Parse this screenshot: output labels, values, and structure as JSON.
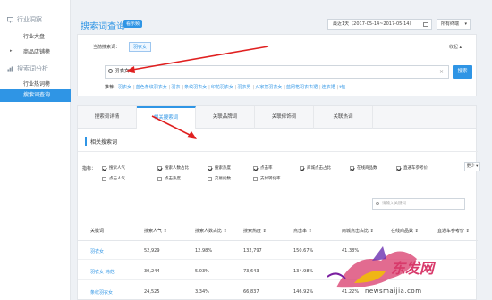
{
  "sidebar": {
    "sections": [
      {
        "label": "行业洞察",
        "icon": "chart-icon"
      },
      {
        "label": "搜索词分析",
        "icon": "bar-chart-icon"
      }
    ],
    "items": [
      {
        "label": "行业大盘"
      },
      {
        "label": "商品店铺榜"
      },
      {
        "label": "行业热词榜"
      },
      {
        "label": "搜索词查询"
      }
    ]
  },
  "header": {
    "title": "搜索词查询",
    "badge": "看示频",
    "date_range": "最近1天（2017-05-14~2017-05-14）",
    "terminal": "所有终端"
  },
  "query": {
    "current_label": "当前搜索词：",
    "current_term": "羽衣女",
    "collapse": "收起",
    "search_value": "羽衣女",
    "search_button": "搜索",
    "recommend_label": "推荐：",
    "recommend": [
      "羽衣女",
      "蓝色条纹羽衣女",
      "羽衣",
      "条纹羽衣女",
      "印花羽衣女",
      "羽衣男",
      "火家撞羽衣女",
      "蓝网格羽衣衣裙",
      "连衣裙",
      "t恤"
    ]
  },
  "tabs": [
    "搜索词详情",
    "相关搜索词",
    "关联品牌词",
    "关联修饰词",
    "关联热词"
  ],
  "section_title": "相关搜索词",
  "indicators": {
    "label": "指标：",
    "more": "更少",
    "items": [
      {
        "label": "搜索人气",
        "checked": true
      },
      {
        "label": "搜索人数占比",
        "checked": true
      },
      {
        "label": "搜索热度",
        "checked": true
      },
      {
        "label": "点击率",
        "checked": true
      },
      {
        "label": "商城点击占比",
        "checked": true
      },
      {
        "label": "在线商品数",
        "checked": true
      },
      {
        "label": "直通车参考价",
        "checked": true
      },
      {
        "label": "点击人气",
        "checked": false
      },
      {
        "label": "点击热度",
        "checked": false
      },
      {
        "label": "交易指数",
        "checked": false
      },
      {
        "label": "支付转化率",
        "checked": false
      }
    ]
  },
  "keyword_placeholder": "请输入关键词",
  "table": {
    "headers": [
      "关键词",
      "搜索人气",
      "搜索人数占比",
      "搜索热度",
      "点击率",
      "商城点击占比",
      "在线商品数",
      "直通车参考价"
    ],
    "rows": [
      [
        "羽衣女",
        "52,929",
        "12.98%",
        "132,797",
        "150.67%",
        "41.38%",
        "",
        ""
      ],
      [
        "羽衣女 韩范",
        "30,244",
        "5.03%",
        "73,643",
        "134.98%",
        "",
        "",
        ""
      ],
      [
        "条纹羽衣女",
        "24,525",
        "3.34%",
        "66,837",
        "146.92%",
        "41.22%",
        "",
        ""
      ]
    ]
  },
  "watermark": {
    "title": "东发网",
    "url": "newsmaijia.com"
  },
  "colors": {
    "accent": "#2f95e5",
    "annotation_arrow": "#e02020"
  }
}
